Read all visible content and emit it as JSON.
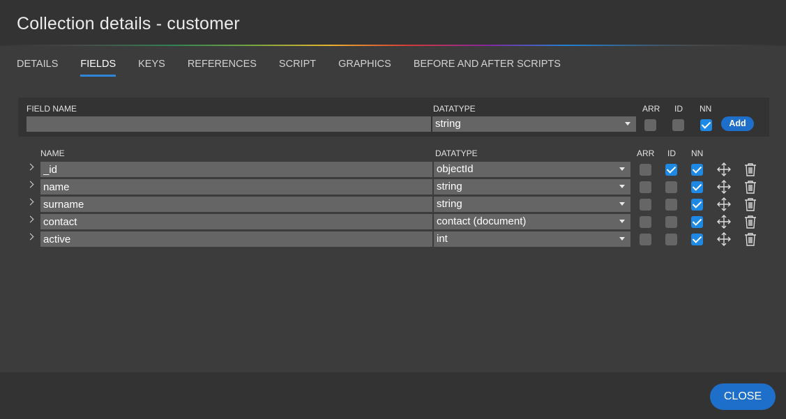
{
  "dialog": {
    "title": "Collection details - customer"
  },
  "tabs": [
    {
      "label": "DETAILS"
    },
    {
      "label": "FIELDS",
      "active": true
    },
    {
      "label": "KEYS"
    },
    {
      "label": "REFERENCES"
    },
    {
      "label": "SCRIPT"
    },
    {
      "label": "GRAPHICS"
    },
    {
      "label": "BEFORE AND AFTER SCRIPTS"
    }
  ],
  "new_field": {
    "name_label": "FIELD NAME",
    "name_value": "",
    "datatype_label": "DATATYPE",
    "datatype_value": "string",
    "arr_label": "ARR",
    "id_label": "ID",
    "nn_label": "NN",
    "arr": false,
    "id": false,
    "nn": true,
    "add_label": "Add"
  },
  "fields_header": {
    "name": "NAME",
    "datatype": "DATATYPE",
    "arr": "ARR",
    "id": "ID",
    "nn": "NN"
  },
  "fields": [
    {
      "name": "_id",
      "datatype": "objectId",
      "arr": false,
      "id": true,
      "nn": true
    },
    {
      "name": "name",
      "datatype": "string",
      "arr": false,
      "id": false,
      "nn": true
    },
    {
      "name": "surname",
      "datatype": "string",
      "arr": false,
      "id": false,
      "nn": true
    },
    {
      "name": "contact",
      "datatype": "contact (document)",
      "arr": false,
      "id": false,
      "nn": true
    },
    {
      "name": "active",
      "datatype": "int",
      "arr": false,
      "id": false,
      "nn": true
    }
  ],
  "icons": {
    "expand": "chevron-right-icon",
    "move": "move-icon",
    "delete": "trash-icon"
  },
  "colors": {
    "accent": "#1e6fc9",
    "checkbox_on": "#1e88e5",
    "tab_underline": "#2f86d8"
  },
  "footer": {
    "close_label": "CLOSE"
  }
}
